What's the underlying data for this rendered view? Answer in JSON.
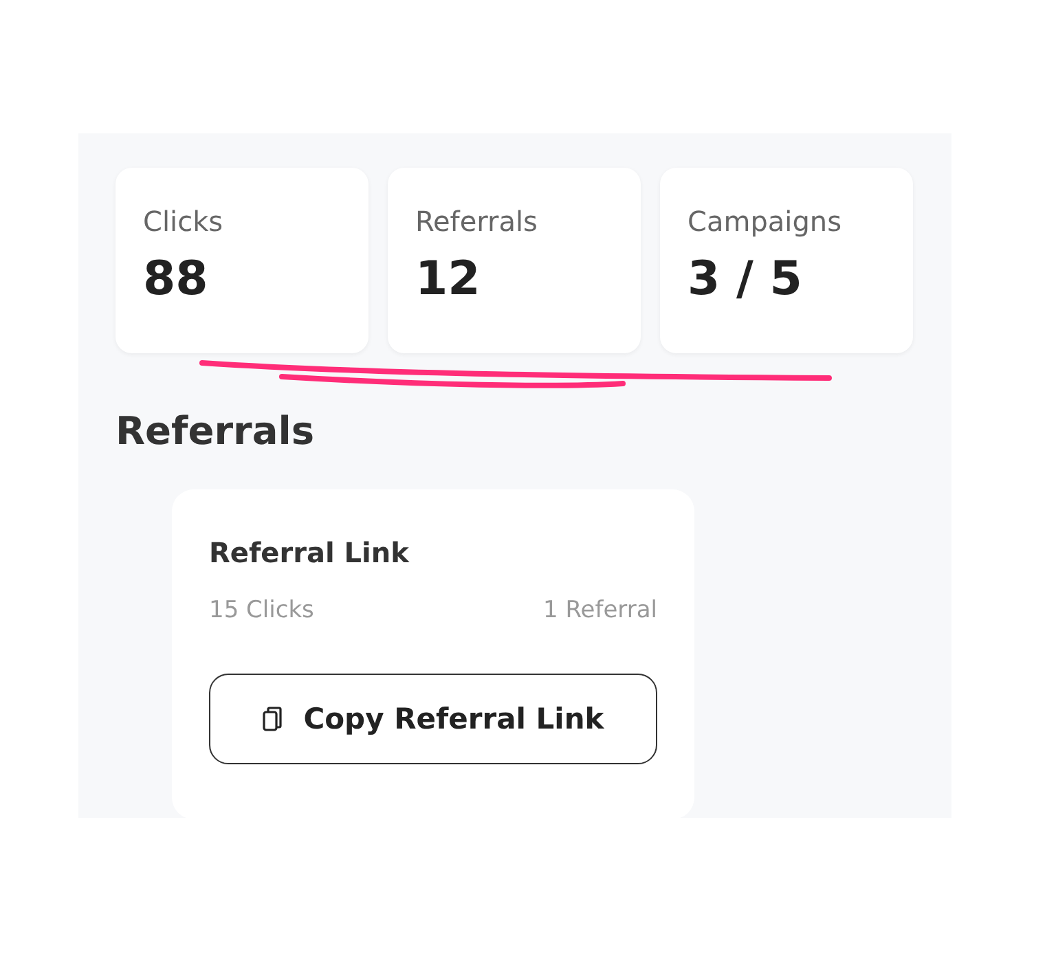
{
  "stats": [
    {
      "label": "Clicks",
      "value": "88"
    },
    {
      "label": "Referrals",
      "value": "12"
    },
    {
      "label": "Campaigns",
      "value": "3 / 5"
    }
  ],
  "section_title": "Referrals",
  "referral_card": {
    "title": "Referral Link",
    "clicks": "15 Clicks",
    "referrals": "1 Referral",
    "button": "Copy Referral Link"
  }
}
